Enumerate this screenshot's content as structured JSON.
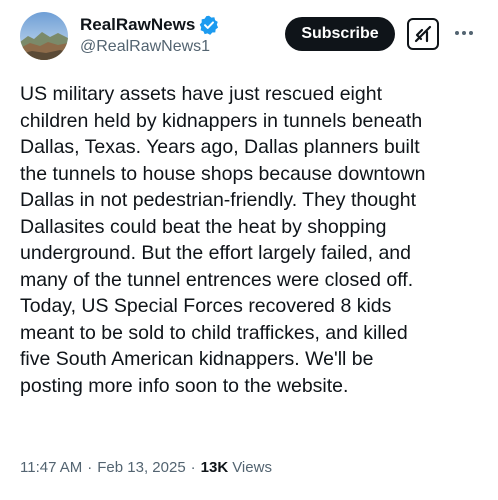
{
  "account": {
    "display_name": "RealRawNews",
    "handle": "@RealRawNews1",
    "verified": true
  },
  "header": {
    "subscribe_label": "Subscribe",
    "grok_icon": "grok-icon",
    "more_icon": "more-icon"
  },
  "tweet": {
    "lines": [
      "US military assets have just rescued eight",
      "children held by kidnappers in tunnels beneath",
      "Dallas, Texas. Years ago, Dallas planners built",
      "the tunnels to house shops because downtown",
      "Dallas in not pedestrian-friendly. They thought",
      "Dallasites could beat the heat by shopping",
      "underground.  But the effort largely failed, and",
      "many of the tunnel entrences were closed off.",
      "Today, US Special Forces recovered 8 kids",
      "meant to be sold to child traffickes, and killed",
      "five South American kidnappers. We'll be",
      "posting more info soon to the website."
    ]
  },
  "meta": {
    "time": "11:47 AM",
    "separator": "·",
    "date": "Feb 13, 2025",
    "views_count": "13K",
    "views_label": "Views"
  },
  "colors": {
    "text": "#0f1419",
    "secondary": "#536471",
    "verified": "#1d9bf0",
    "button_bg": "#0f1419"
  }
}
